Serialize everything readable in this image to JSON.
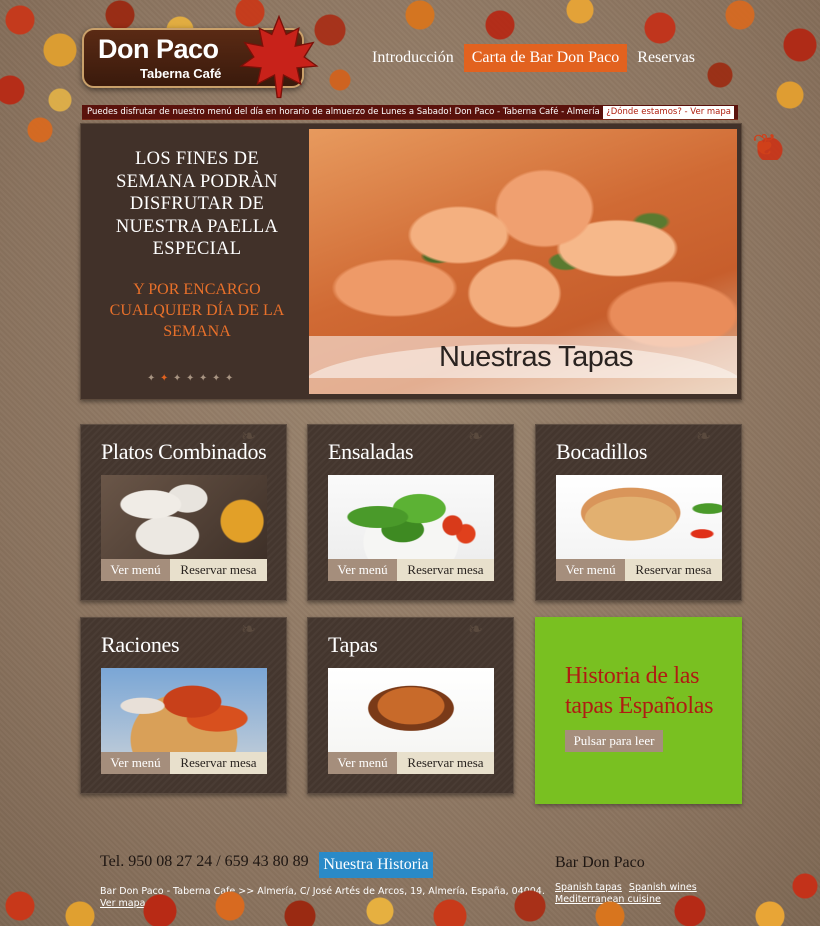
{
  "brand": {
    "name": "Don Paco",
    "tagline": "Taberna Café"
  },
  "nav": {
    "items": [
      {
        "label": "Introducción"
      },
      {
        "label": "Carta de Bar Don Paco"
      },
      {
        "label": "Reservas"
      }
    ]
  },
  "ticker": {
    "text": "Puedes disfrutar de nuestro menú del día en horario de almuerzo de Lunes a Sabado! Don Paco - Taberna Café - Almería",
    "where_link": "¿Dónde estamos? - Ver mapa"
  },
  "hero": {
    "text_main": "LOS FINES DE SEMANA PODRÀN DISFRUTAR DE NUESTRA PAELLA ESPECIAL",
    "text_sub": "Y POR ENCARGO CUALQUIER DÍA DE LA SEMANA",
    "caption": "Nuestras Tapas",
    "slide_count": 7,
    "active_slide": 2
  },
  "cards": [
    {
      "title": "Platos Combinados",
      "menu_label": "Ver menú",
      "reserve_label": "Reservar mesa"
    },
    {
      "title": "Ensaladas",
      "menu_label": "Ver menú",
      "reserve_label": "Reservar mesa"
    },
    {
      "title": "Bocadillos",
      "menu_label": "Ver menú",
      "reserve_label": "Reservar mesa"
    },
    {
      "title": "Raciones",
      "menu_label": "Ver menú",
      "reserve_label": "Reservar mesa"
    },
    {
      "title": "Tapas",
      "menu_label": "Ver menú",
      "reserve_label": "Reservar mesa"
    }
  ],
  "historia": {
    "title": "Historia de las tapas Españolas",
    "button": "Pulsar para leer"
  },
  "footer": {
    "phone": "Tel. 950 08 27 24 / 659 43 80 89",
    "historia_link": "Nuestra Historia",
    "address": "Bar Don Paco - Taberna Cafe >> Almería, C/ José Artés de Arcos, 19, Almería, España, 04004.",
    "map_link": "Ver mapa",
    "brand": "Bar Don Paco",
    "links": [
      "Spanish tapas",
      "Spanish wines",
      "Mediterranean cuisine"
    ]
  },
  "colors": {
    "accent": "#e2621f",
    "panel": "#463830",
    "historia_bg": "#79c021",
    "historia_text": "#b01c12",
    "historia_link_bg": "#2a8ac8"
  }
}
